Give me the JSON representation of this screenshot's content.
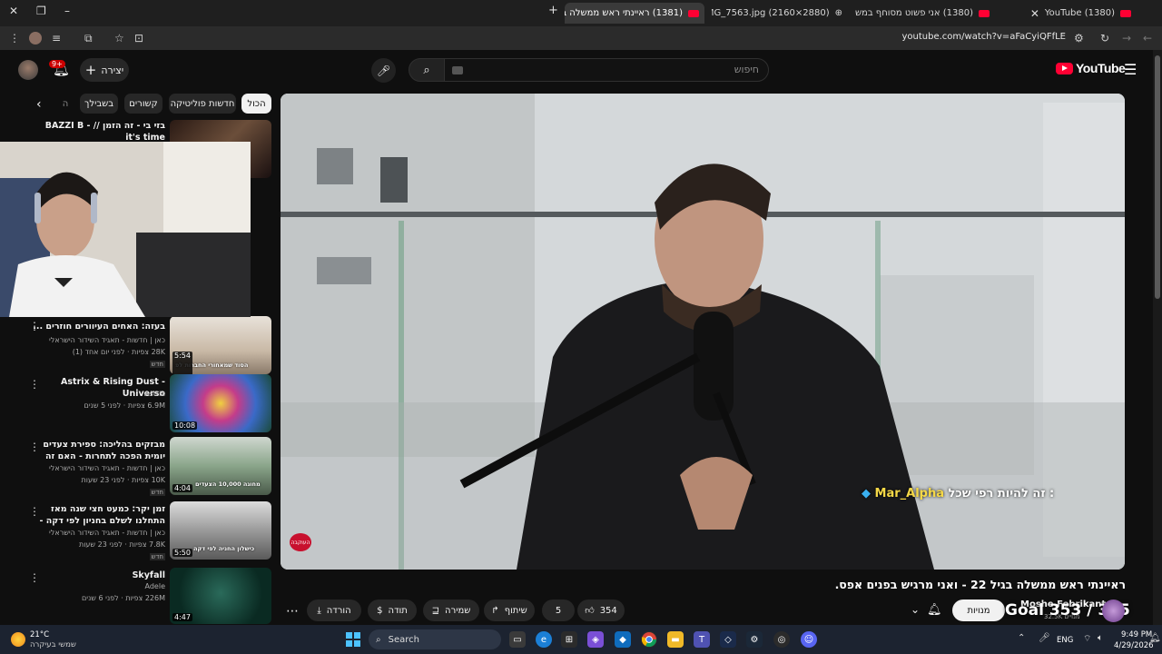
{
  "browser": {
    "tabs": [
      {
        "title": "(1380) YouTube",
        "active": false
      },
      {
        "title": "(1380) אני פשוט מסוחף במשחק",
        "active": false
      },
      {
        "title": "IMG_7563.jpg (2160×2880)",
        "active": false
      },
      {
        "title": "(1381) ראיינתי ראש ממשלה בג...",
        "active": true
      }
    ],
    "new_tab": "+",
    "url": "youtube.com/watch?v=aFaCyiQFfLE"
  },
  "yt": {
    "logo_text": "YouTube",
    "search_placeholder": "חיפוש",
    "create_label": "יצירה",
    "notif_badge": "9+"
  },
  "chips": [
    "הכול",
    "חדשות פוליטיקה",
    "קשורים",
    "בשבילך",
    "ה"
  ],
  "recommended": [
    {
      "title": "בזי בי - זה הזמן // BAZZI B - it's time",
      "meta1": "",
      "meta2": "",
      "duration": "",
      "new": ""
    },
    {
      "title": "בעזה: האחים העיוורים חוזרים ...",
      "meta1": "כאן | חדשות - תאגיד השידור הישראלי",
      "meta2": "28K צפיות · לפני יום אחד (1)",
      "duration": "5:54",
      "new": "חדש",
      "thumb_text": "הסוד שמאחורי החברות לפ"
    },
    {
      "title": "Astrix & Rising Dust - Universo",
      "meta1": "Astrix",
      "meta2": "6.9M צפיות · לפני 5 שנים",
      "duration": "10:08",
      "new": ""
    },
    {
      "title": "מבזקים בהליכה: ספירת צעדים יומית הפכה לתחרות - האם זה באמת ...",
      "meta1": "כאן | חדשות - תאגיד השידור הישראלי",
      "meta2": "10K צפיות · לפני 23 שעות",
      "duration": "4:04",
      "new": "חדש",
      "thumb_text": "מחוגה 10,000 הצעדים"
    },
    {
      "title": "זמן יקר: כמעט חצי שנה מאז התחלנו לשלם בחניון לפי דקה - כמה זה עלה...",
      "meta1": "כאן | חדשות - תאגיד השידור הישראלי",
      "meta2": "7.8K צפיות · לפני 23 שעות",
      "duration": "5:50",
      "new": "חדש",
      "thumb_text": "כישלון החניה לפי דקה"
    },
    {
      "title": "Skyfall",
      "meta1": "Adele",
      "meta2": "226M צפיות · לפני 6 שנים",
      "duration": "4:47",
      "new": ""
    }
  ],
  "player": {
    "chat_user": "Mar_Alpha",
    "chat_text": ": זה להיות רפי שכל",
    "live_badge": "העוקבה"
  },
  "video": {
    "title": "ראיינתי ראש ממשלה בגיל 22 - ואני מרגיש בפנים אפס.",
    "likes": "354",
    "comments_count": "5",
    "share_label": "שיתוף",
    "save_label": "שמירה",
    "thanks_label": "תודה",
    "download_label": "הורדה",
    "subscribe_label": "מנויות",
    "channel_name": "Moshe Febrikant",
    "channel_subs": "32.5K מנויים",
    "goal_overlay": "Goal 353 / 365"
  },
  "taskbar": {
    "weather_temp": "21°C",
    "weather_desc": "שמשי בעיקרה",
    "search_label": "Search",
    "lang": "ENG",
    "time": "9:49 PM",
    "date": "4/29/2026"
  },
  "colors": {
    "accent_red": "#ff0033",
    "background": "#0f0f0f",
    "chip_bg": "#272727"
  }
}
